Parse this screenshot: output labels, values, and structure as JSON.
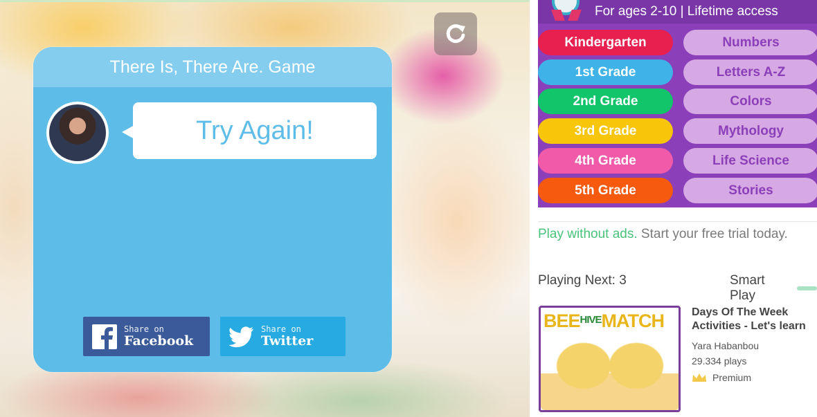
{
  "game": {
    "card_title": "There Is, There Are. Game",
    "result_message": "Try Again!",
    "restart_icon": "refresh-icon",
    "share": {
      "facebook": {
        "small": "Share on",
        "big": "Facebook"
      },
      "twitter": {
        "small": "Share on",
        "big": "Twitter"
      }
    }
  },
  "promo": {
    "tagline": "For ages 2-10 | Lifetime access",
    "grades": [
      {
        "label": "Kindergarten",
        "color": "#e8204f"
      },
      {
        "label": "1st Grade",
        "color": "#3fb3e8"
      },
      {
        "label": "2nd Grade",
        "color": "#12c46a"
      },
      {
        "label": "3rd Grade",
        "color": "#f7c60a"
      },
      {
        "label": "4th Grade",
        "color": "#f05aa8"
      },
      {
        "label": "5th Grade",
        "color": "#f55a0f"
      }
    ],
    "topics": [
      "Numbers",
      "Letters A-Z",
      "Colors",
      "Mythology",
      "Life Science",
      "Stories"
    ]
  },
  "trial": {
    "highlight": "Play without ads.",
    "rest": " Start your free trial today."
  },
  "queue": {
    "playing_next": "Playing Next: 3",
    "smart_play": "Smart Play",
    "next_game": {
      "thumb_title_part1": "BEE",
      "thumb_title_part2": "HIVE",
      "thumb_title_part3": "MATCH",
      "title": "Days Of The Week Activities - Let's learn",
      "author": "Yara Habanbou",
      "plays": "29.334 plays",
      "tier": "Premium"
    }
  }
}
